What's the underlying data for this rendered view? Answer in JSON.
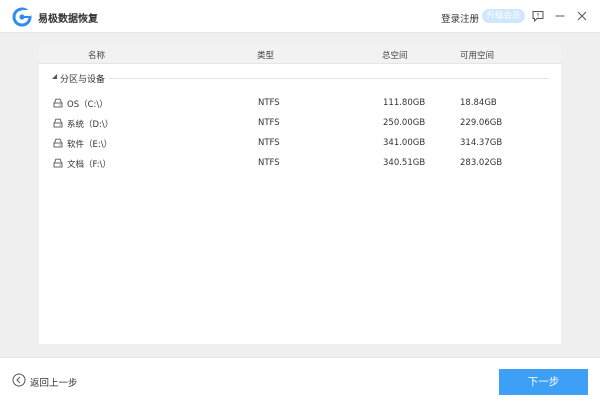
{
  "app": {
    "title": "易极数据恢复",
    "brand_color": "#3d9ff5"
  },
  "header": {
    "login_label": "登录注册",
    "upgrade_label": "升级会员",
    "icons": [
      "feedback-icon",
      "minimize-icon",
      "close-icon"
    ]
  },
  "table": {
    "columns": {
      "name": "名称",
      "type": "类型",
      "total": "总空间",
      "free": "可用空间"
    },
    "group_label": "分区与设备",
    "rows": [
      {
        "name": "OS（C:\\）",
        "type": "NTFS",
        "total": "111.80GB",
        "free": "18.84GB"
      },
      {
        "name": "系统（D:\\）",
        "type": "NTFS",
        "total": "250.00GB",
        "free": "229.06GB"
      },
      {
        "name": "软件（E:\\）",
        "type": "NTFS",
        "total": "341.00GB",
        "free": "314.37GB"
      },
      {
        "name": "文档（F:\\）",
        "type": "NTFS",
        "total": "340.51GB",
        "free": "283.02GB"
      }
    ]
  },
  "footer": {
    "back_label": "返回上一步",
    "next_label": "下一步"
  }
}
